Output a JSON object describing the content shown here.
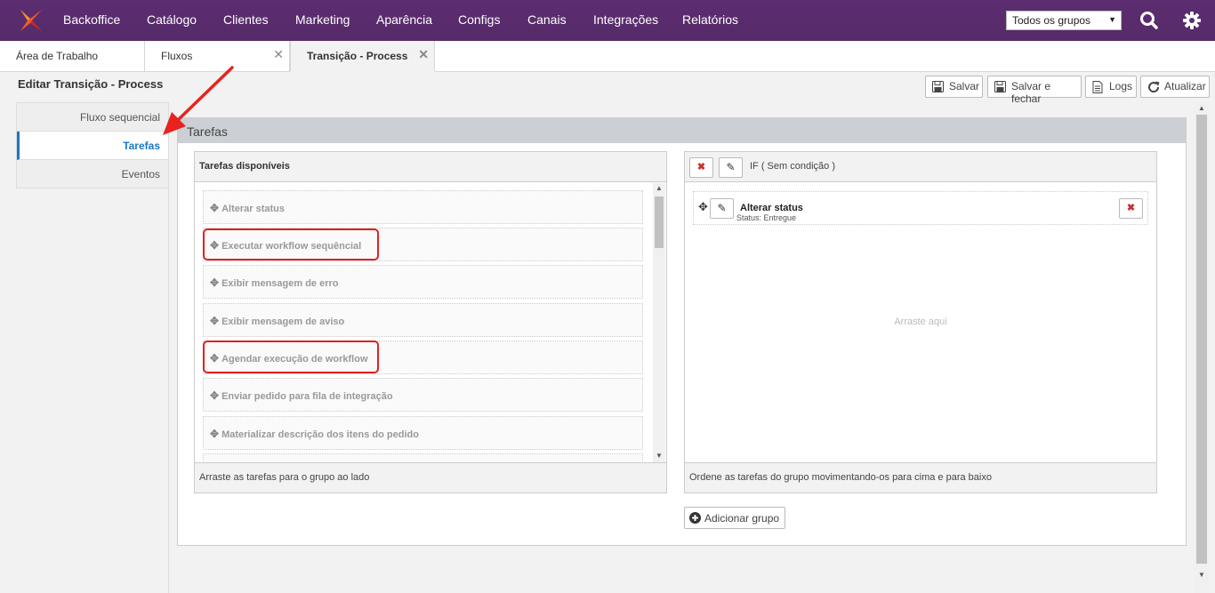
{
  "nav": {
    "items": [
      "Backoffice",
      "Catálogo",
      "Clientes",
      "Marketing",
      "Aparência",
      "Configs",
      "Canais",
      "Integrações",
      "Relatórios"
    ],
    "group_select": "Todos os grupos",
    "brand_color": "#5c2d70"
  },
  "tabs": [
    {
      "label": "Área de Trabalho"
    },
    {
      "label": "Fluxos",
      "close": "✕"
    },
    {
      "label": "Transição - Process",
      "close": "✕"
    }
  ],
  "page": {
    "title": "Editar Transição - Process"
  },
  "toolbar": {
    "save": "Salvar",
    "save_close": "Salvar e fechar",
    "logs": "Logs",
    "refresh": "Atualizar"
  },
  "sidemenu": {
    "items": [
      "Fluxo sequencial",
      "Tarefas",
      "Eventos"
    ],
    "active": "Tarefas"
  },
  "section": {
    "title": "Tarefas"
  },
  "available": {
    "header": "Tarefas disponíveis",
    "footer": "Arraste as tarefas para o grupo ao lado",
    "tasks": [
      "Alterar status",
      "Executar workflow sequêncial",
      "Exibir mensagem de erro",
      "Exibir mensagem de aviso",
      "Agendar execução de workflow",
      "Enviar pedido para fila de integração",
      "Materializar descrição dos itens do pedido"
    ]
  },
  "group": {
    "condition": "IF ( Sem condição )",
    "task_title": "Alterar status",
    "task_sub": "Status: Entregue",
    "drop_hint": "Arraste aqui",
    "footer": "Ordene as tarefas do grupo movimentando-os para cima e para baixo",
    "add_group": "Adicionar grupo"
  }
}
